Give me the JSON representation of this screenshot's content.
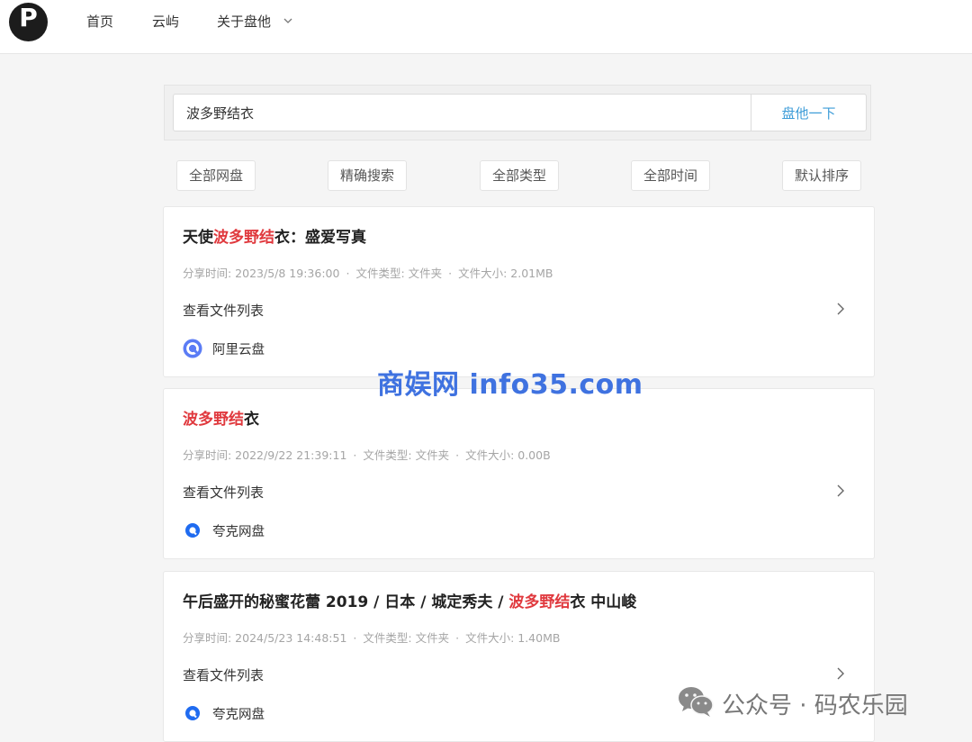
{
  "header": {
    "logo_letter": "P",
    "nav": [
      "首页",
      "云屿",
      "关于盘他"
    ]
  },
  "search": {
    "value": "波多野结衣",
    "button_label": "盘他一下"
  },
  "filters": [
    "全部网盘",
    "精确搜索",
    "全部类型",
    "全部时间",
    "默认排序"
  ],
  "results": [
    {
      "title_pre": "天使",
      "title_hl": "波多野结",
      "title_post": "衣：盛爱写真",
      "share_time": "分享时间: 2023/5/8 19:36:00",
      "file_type": "文件类型: 文件夹",
      "file_size": "文件大小: 2.01MB",
      "view_label": "查看文件列表",
      "source": "阿里云盘"
    },
    {
      "title_pre": "",
      "title_hl": "波多野结",
      "title_post": "衣",
      "share_time": "分享时间: 2022/9/22 21:39:11",
      "file_type": "文件类型: 文件夹",
      "file_size": "文件大小: 0.00B",
      "view_label": "查看文件列表",
      "source": "夸克网盘"
    },
    {
      "title_pre": "午后盛开的秘蜜花蕾 2019 / 日本 / 城定秀夫 / ",
      "title_hl": "波多野结",
      "title_post": "衣 中山峻",
      "share_time": "分享时间: 2024/5/23 14:48:51",
      "file_type": "文件类型: 文件夹",
      "file_size": "文件大小: 1.40MB",
      "view_label": "查看文件列表",
      "source": "夸克网盘"
    }
  ],
  "watermarks": {
    "site": "商娱网 info35.com",
    "wechat": "公众号 · 码农乐园"
  },
  "icons": {
    "nav_dropdown": "chevron-down-icon",
    "expand": "chevron-right-icon",
    "aliyun": "aliyun-drive-icon",
    "quark": "quark-drive-icon",
    "wechat": "wechat-icon"
  },
  "colors": {
    "highlight": "#e0393e",
    "search_button_text": "#3d9cd8",
    "watermark": "#3f72e0"
  }
}
